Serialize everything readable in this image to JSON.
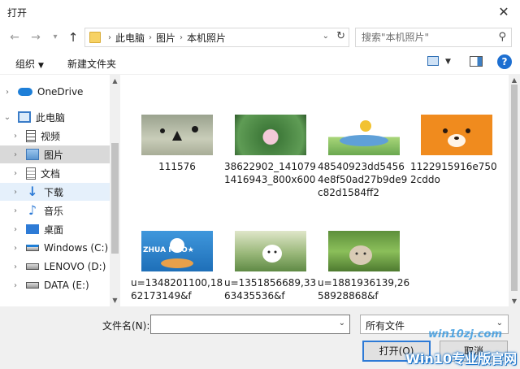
{
  "window": {
    "title": "打开"
  },
  "nav": {
    "back": "←",
    "forward": "→",
    "recent": "▾",
    "up": "↑",
    "breadcrumbs": [
      "此电脑",
      "图片",
      "本机照片"
    ],
    "search_placeholder": "搜索\"本机照片\""
  },
  "toolbar": {
    "organize": "组织",
    "new_folder": "新建文件夹"
  },
  "sidebar": {
    "items": [
      {
        "label": "OneDrive",
        "icon": "cloud-icon",
        "color": "#1e7fd8"
      },
      {
        "label": "此电脑",
        "icon": "computer-icon",
        "color": "#3a7cc8"
      },
      {
        "label": "视频",
        "icon": "video-icon",
        "color": "#555555"
      },
      {
        "label": "图片",
        "icon": "pictures-icon",
        "color": "#3f78b8"
      },
      {
        "label": "文档",
        "icon": "documents-icon",
        "color": "#666666"
      },
      {
        "label": "下载",
        "icon": "download-icon",
        "color": "#2e7bd6"
      },
      {
        "label": "音乐",
        "icon": "music-icon",
        "color": "#2e7bd6"
      },
      {
        "label": "桌面",
        "icon": "desktop-icon",
        "color": "#2e7bd6"
      },
      {
        "label": "Windows (C:)",
        "icon": "drive-windows-icon",
        "color": "#555555"
      },
      {
        "label": "LENOVO (D:)",
        "icon": "drive-icon",
        "color": "#555555"
      },
      {
        "label": "DATA (E:)",
        "icon": "drive-icon",
        "color": "#555555"
      }
    ]
  },
  "files": [
    {
      "name": "111576"
    },
    {
      "name": "38622902_1410791416943_800x600"
    },
    {
      "name": "48540923dd54564e8f50ad27b9de9c82d1584ff2"
    },
    {
      "name": "1122915916e7502cddo"
    },
    {
      "name": "u=1348201100,1862173149&f"
    },
    {
      "name": "u=1351856689,3363435536&f"
    },
    {
      "name": "u=1881936139,2658928868&f"
    }
  ],
  "thumb_text": {
    "zhuanao": "ZHUA MAO★"
  },
  "bottom": {
    "filename_label": "文件名(N):",
    "filename_value": "",
    "filetype_value": "所有文件",
    "open_label": "打开(O)",
    "cancel_label": "取消"
  },
  "watermark": {
    "url": "win10zj.com",
    "brand": "Win10专业版官网"
  }
}
